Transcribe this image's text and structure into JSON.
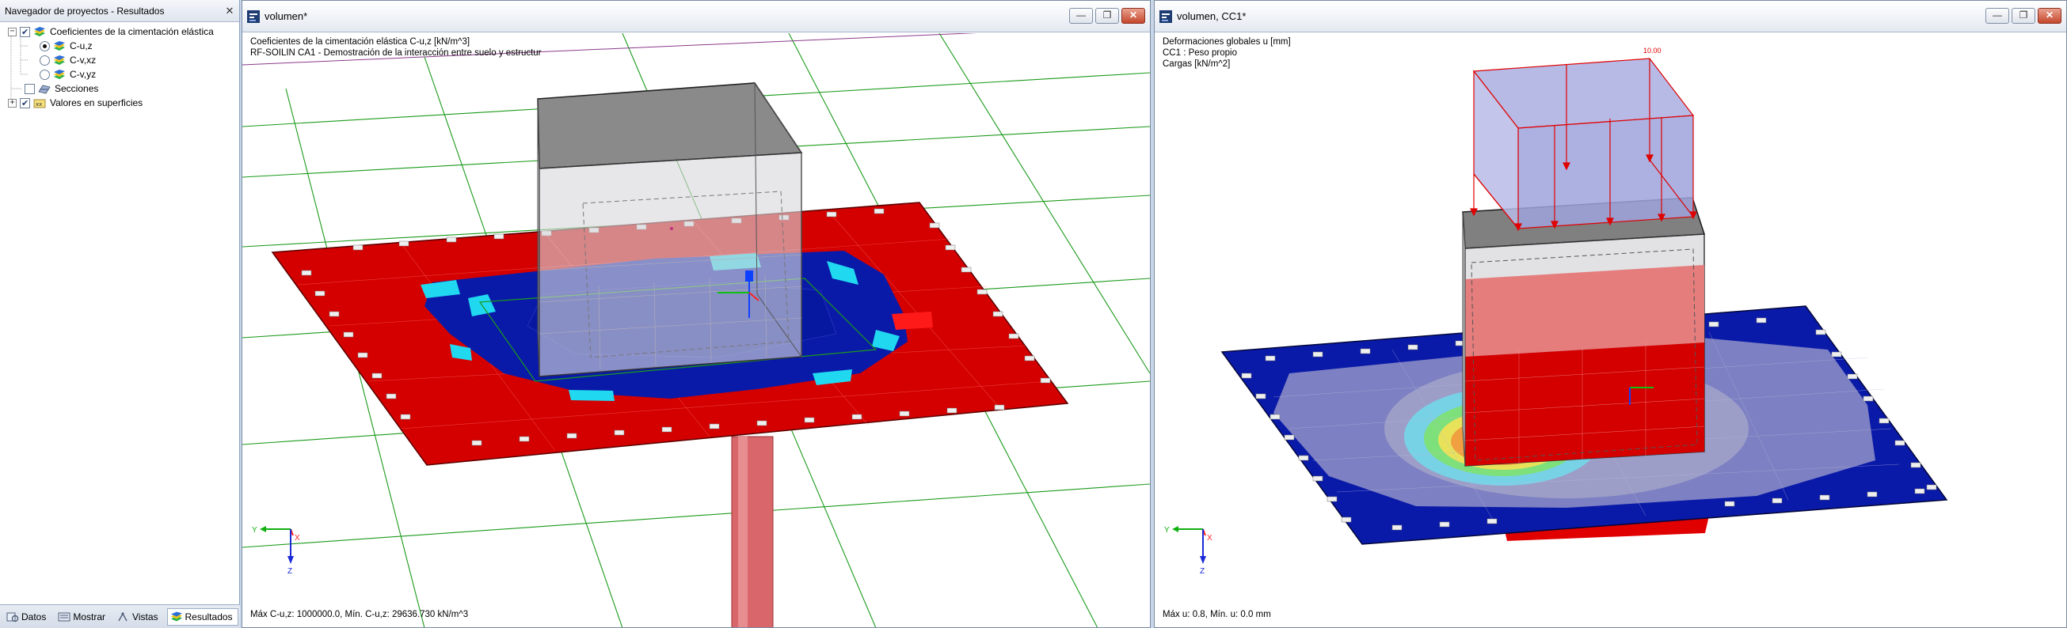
{
  "navigator": {
    "title": "Navegador de proyectos - Resultados",
    "tree": {
      "coef_label": "Coeficientes de la cimentación elástica",
      "cuz_label": "C-u,z",
      "cvxz_label": "C-v,xz",
      "cvyz_label": "C-v,yz",
      "secciones_label": "Secciones",
      "valores_label": "Valores en superficies"
    },
    "tabs": {
      "datos": "Datos",
      "mostrar": "Mostrar",
      "vistas": "Vistas",
      "resultados": "Resultados"
    }
  },
  "window1": {
    "title": "volumen*",
    "info_line1": "Coeficientes de la cimentación elástica C-u,z [kN/m^3]",
    "info_line2": "RF-SOILIN CA1 - Demostración de la interacción entre suelo y estructur",
    "footer": "Máx C-u,z: 1000000.0, Mín. C-u,z: 29636.730 kN/m^3",
    "axis_y": "Y",
    "axis_x": "X",
    "axis_z": "Z"
  },
  "window2": {
    "title": "volumen, CC1*",
    "info_line1": "Deformaciones globales u [mm]",
    "info_line2": "CC1 : Peso propio",
    "info_line3": "Cargas [kN/m^2]",
    "load_label": "10.00",
    "footer": "Máx u: 0.8, Mín. u: 0.0 mm",
    "axis_y": "Y",
    "axis_x": "X",
    "axis_z": "Z"
  },
  "window_buttons": {
    "minimize": "—",
    "restore": "❐",
    "close": "✕"
  },
  "colors": {
    "accent": "#1e3c72",
    "slab_red": "#d40000",
    "slab_blue": "#0a1aa8",
    "cyan": "#20d8f0",
    "grid_green": "#1a9a1a",
    "load_red": "#e00000"
  }
}
